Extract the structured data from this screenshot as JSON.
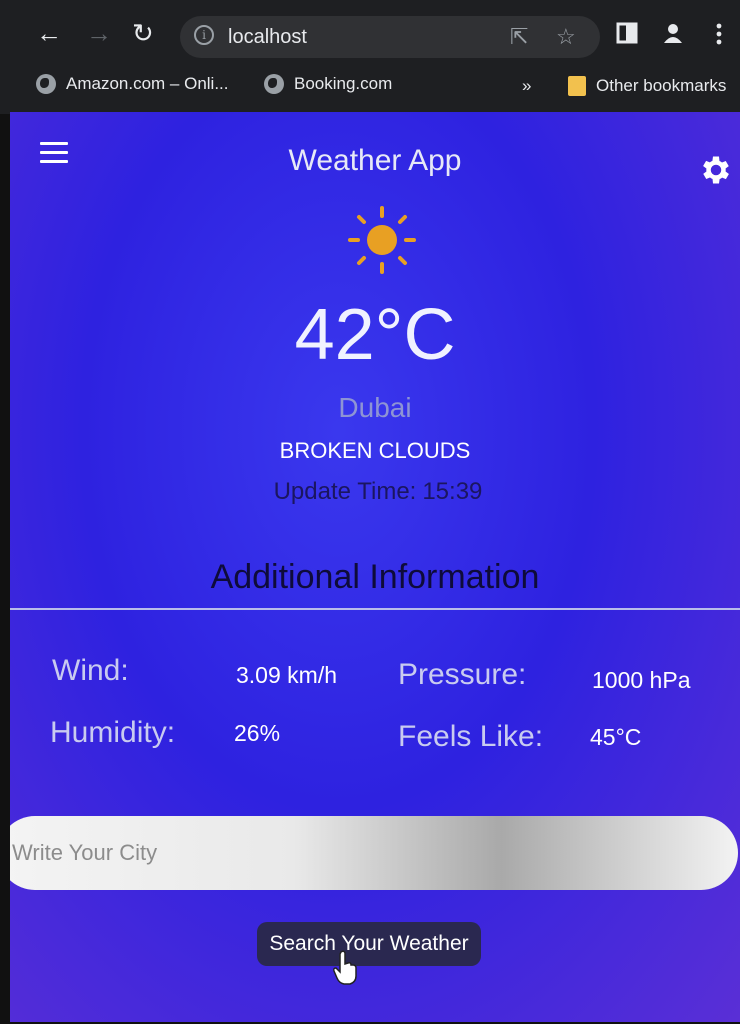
{
  "browser": {
    "url": "localhost",
    "bookmarks": [
      {
        "label": "Amazon.com – Onli...",
        "icon": "globe-icon"
      },
      {
        "label": "Booking.com",
        "icon": "globe-icon"
      }
    ],
    "overflow": "»",
    "other_bookmarks": "Other bookmarks"
  },
  "app": {
    "title": "Weather App",
    "weather_icon": "sun-icon",
    "temperature": "42°C",
    "city": "Dubai",
    "description": "BROKEN CLOUDS",
    "update_label": "Update Time:",
    "update_time": "15:39",
    "additional_heading": "Additional Information",
    "info": {
      "wind_label": "Wind:",
      "wind_value": "3.09 km/h",
      "pressure_label": "Pressure:",
      "pressure_value": "1000 hPa",
      "humidity_label": "Humidity:",
      "humidity_value": "26%",
      "feels_label": "Feels Like:",
      "feels_value": "45°C"
    },
    "search_placeholder": "Write Your City",
    "search_button": "Search Your Weather"
  },
  "colors": {
    "background": "#3a38ee",
    "sun": "#e8a023",
    "button": "#2a2850"
  }
}
